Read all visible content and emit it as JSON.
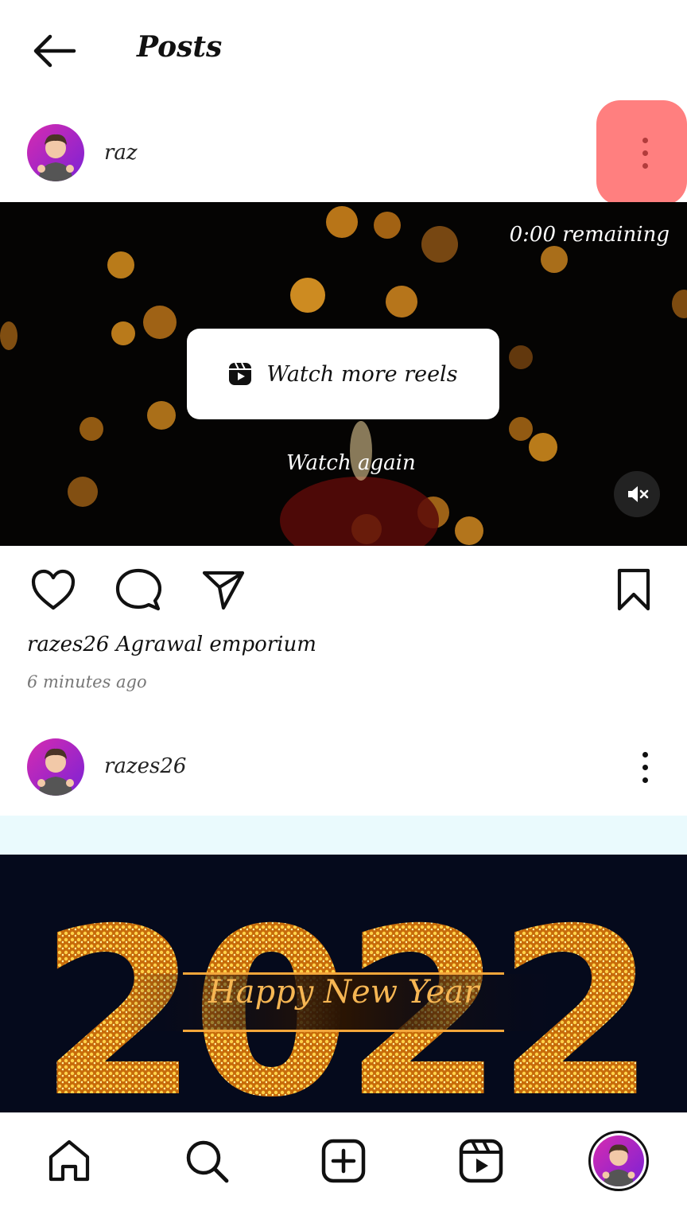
{
  "header": {
    "title": "Posts",
    "back_icon": "arrow-left-icon"
  },
  "post1": {
    "username": "raz",
    "more_icon": "more-vertical-icon",
    "video": {
      "remaining": "0:00 remaining",
      "watch_more_label": "Watch more reels",
      "watch_more_icon": "reels-icon",
      "watch_again_label": "Watch again",
      "mute_icon": "volume-muted-icon"
    },
    "actions": {
      "like_icon": "heart-icon",
      "comment_icon": "comment-icon",
      "share_icon": "send-icon",
      "save_icon": "bookmark-icon"
    },
    "caption_user": "razes26",
    "caption_text": "Agrawal emporium",
    "timestamp": "6 minutes ago"
  },
  "post2": {
    "username": "razes26",
    "more_icon": "more-vertical-icon",
    "image_text": "Happy New Year"
  },
  "nav": {
    "home_icon": "home-icon",
    "search_icon": "search-icon",
    "create_icon": "plus-square-icon",
    "reels_icon": "reels-icon",
    "profile": "profile-avatar"
  },
  "colors": {
    "highlight": "#ff7f7f",
    "accent_gradient_start": "#d62bb0",
    "accent_gradient_end": "#7b22d6"
  }
}
